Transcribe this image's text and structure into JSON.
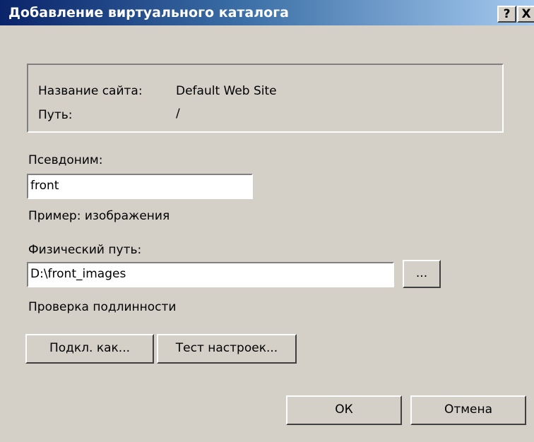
{
  "window": {
    "title": "Добавление виртуального каталога",
    "help_button": "?",
    "close_button": "X"
  },
  "site_info": {
    "site_name_label": "Название сайта:",
    "site_name_value": "Default Web Site",
    "path_label": "Путь:",
    "path_value": "/"
  },
  "alias": {
    "label": "Псевдоним:",
    "value": "front",
    "example": "Пример: изображения"
  },
  "physical_path": {
    "label": "Физический путь:",
    "value": "D:\\front_images",
    "browse_label": "..."
  },
  "auth": {
    "label": "Проверка подлинности"
  },
  "buttons": {
    "connect_as": "Подкл. как...",
    "test_settings": "Тест настроек...",
    "ok": "ОК",
    "cancel": "Отмена"
  }
}
